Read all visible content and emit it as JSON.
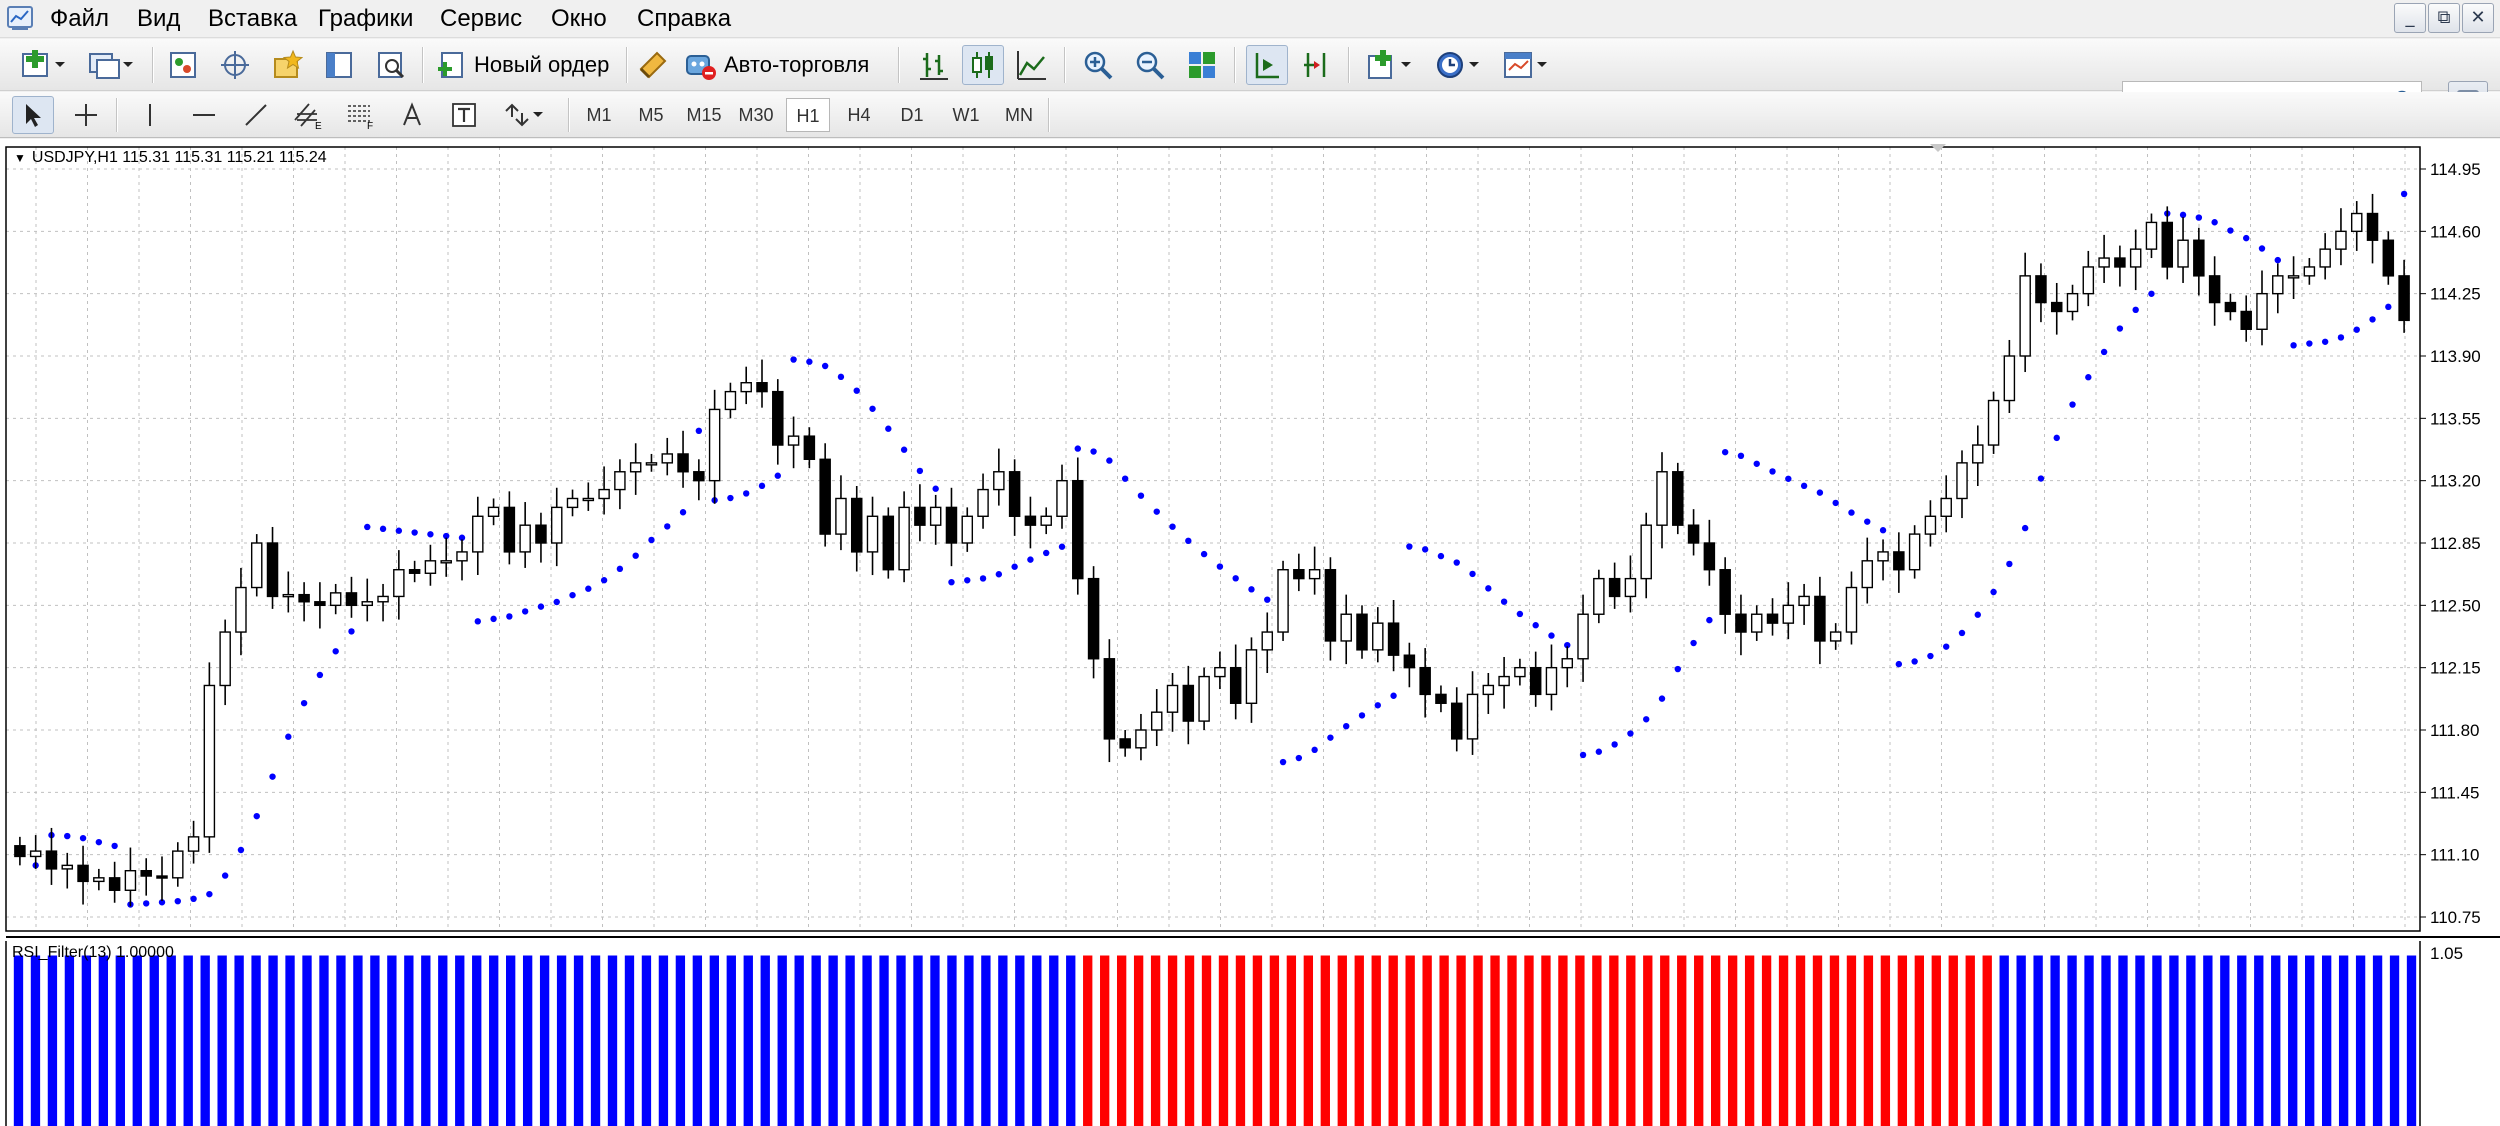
{
  "menu": {
    "items": [
      "Файл",
      "Вид",
      "Вставка",
      "Графики",
      "Сервис",
      "Окно",
      "Справка"
    ]
  },
  "window_buttons": [
    "_",
    "⧉",
    "✕"
  ],
  "toolbar": {
    "new_order_label": "Новый ордер",
    "autotrading_label": "Авто-торговля",
    "search_placeholder": ""
  },
  "timeframes": {
    "items": [
      "M1",
      "M5",
      "M15",
      "M30",
      "H1",
      "H4",
      "D1",
      "W1",
      "MN"
    ],
    "active": "H1"
  },
  "colors": {
    "bull_body": "#ffffff",
    "bear_body": "#000000",
    "sar_dots": "#0000ff",
    "osc_blue": "#0000ff",
    "osc_red": "#ff0000",
    "grid": "#c0c0c0"
  },
  "chart": {
    "symbol_line": "USDJPY,H1  115.31 115.31 115.21 115.24",
    "oscillator_label": "RSI_Filter(13) 1.00000",
    "oscillator_max_label": "1.05"
  },
  "chart_data": {
    "type": "candlestick",
    "symbol": "USDJPY",
    "timeframe": "H1",
    "ohlc_header": {
      "open": 115.31,
      "high": 115.31,
      "low": 115.21,
      "close": 115.24
    },
    "y_ticks": [
      114.95,
      114.6,
      114.25,
      113.9,
      113.55,
      113.2,
      112.85,
      112.5,
      112.15,
      111.8,
      111.45,
      111.1,
      110.75
    ],
    "ylim": [
      110.75,
      114.95
    ],
    "closes": [
      111.09,
      111.12,
      111.02,
      111.04,
      110.95,
      110.97,
      110.9,
      111.01,
      110.98,
      110.97,
      111.12,
      111.2,
      112.05,
      112.35,
      112.6,
      112.85,
      112.55,
      112.56,
      112.52,
      112.5,
      112.57,
      112.5,
      112.52,
      112.55,
      112.7,
      112.68,
      112.75,
      112.75,
      112.8,
      113.0,
      113.05,
      112.8,
      112.95,
      112.85,
      113.05,
      113.1,
      113.1,
      113.15,
      113.25,
      113.3,
      113.3,
      113.35,
      113.25,
      113.2,
      113.6,
      113.7,
      113.75,
      113.7,
      113.4,
      113.45,
      113.32,
      112.9,
      113.1,
      112.8,
      113.0,
      112.7,
      113.05,
      112.95,
      113.05,
      112.85,
      113.0,
      113.15,
      113.25,
      113.0,
      112.95,
      113.0,
      113.2,
      112.65,
      112.2,
      111.75,
      111.7,
      111.8,
      111.9,
      112.05,
      111.85,
      112.1,
      112.15,
      111.95,
      112.25,
      112.35,
      112.7,
      112.65,
      112.7,
      112.3,
      112.45,
      112.25,
      112.4,
      112.22,
      112.15,
      112.0,
      111.95,
      111.75,
      112.0,
      112.05,
      112.1,
      112.15,
      112.0,
      112.15,
      112.2,
      112.45,
      112.65,
      112.55,
      112.65,
      112.95,
      113.25,
      112.95,
      112.85,
      112.7,
      112.45,
      112.35,
      112.45,
      112.4,
      112.5,
      112.55,
      112.3,
      112.35,
      112.6,
      112.75,
      112.8,
      112.7,
      112.9,
      113.0,
      113.1,
      113.3,
      113.4,
      113.65,
      113.9,
      114.35,
      114.2,
      114.15,
      114.25,
      114.4,
      114.45,
      114.4,
      114.5,
      114.65,
      114.4,
      114.55,
      114.35,
      114.2,
      114.15,
      114.05,
      114.25,
      114.35,
      114.35,
      114.4,
      114.5,
      114.6,
      114.7,
      114.55,
      114.35,
      114.1
    ],
    "oscillator": {
      "name": "RSI_Filter(13)",
      "ylim": [
        0,
        1.05
      ],
      "segments": [
        {
          "color": "blue",
          "bars": 63,
          "value": 1.0
        },
        {
          "color": "red",
          "bars": 54,
          "value": 1.0
        },
        {
          "color": "blue",
          "bars": 25,
          "value": 1.0
        }
      ]
    }
  }
}
